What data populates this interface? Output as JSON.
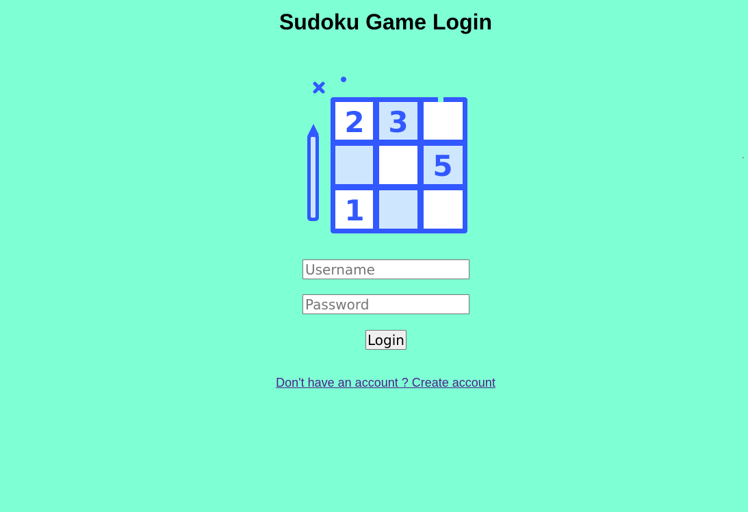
{
  "page": {
    "title": "Sudoku Game Login",
    "background_color": "#7fffd4"
  },
  "logo": {
    "icon": "sudoku-grid-with-pencil-icon",
    "accent_color": "#3258ff",
    "fill_color": "#cfe6ff",
    "cells": [
      "2",
      "3",
      "",
      "",
      "",
      "5",
      "1",
      "",
      ""
    ]
  },
  "form": {
    "username_placeholder": "Username",
    "password_placeholder": "Password",
    "login_label": "Login"
  },
  "footer": {
    "create_account_text": "Don't have an account ? Create account"
  }
}
